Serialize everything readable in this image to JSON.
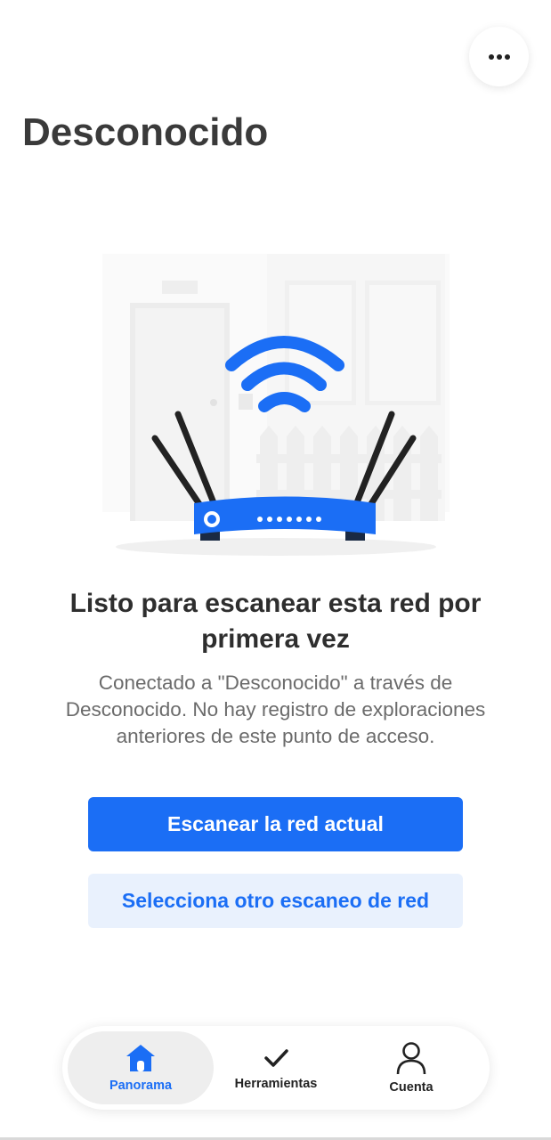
{
  "header": {
    "title": "Desconocido",
    "more_icon": "more-horizontal-icon"
  },
  "illustration": {
    "description_icon": "wifi-router-illustration",
    "accent_color": "#1b6ef5"
  },
  "main": {
    "headline": "Listo para escanear esta red por primera vez",
    "description": "Conectado a \"Desconocido\" a través de Desconocido. No hay registro de exploraciones anteriores de este punto de acceso.",
    "primary_button": "Escanear la red actual",
    "secondary_button": "Selecciona otro escaneo de red"
  },
  "tabbar": {
    "tabs": [
      {
        "label": "Panorama",
        "icon": "home-icon",
        "active": true
      },
      {
        "label": "Herramientas",
        "icon": "check-icon",
        "active": false
      },
      {
        "label": "Cuenta",
        "icon": "user-icon",
        "active": false
      }
    ]
  },
  "colors": {
    "accent": "#1b6ef5",
    "secondary_button_bg": "#e9f1fd",
    "title_text": "#3a3a3a",
    "muted_text": "#6b6b6b"
  }
}
